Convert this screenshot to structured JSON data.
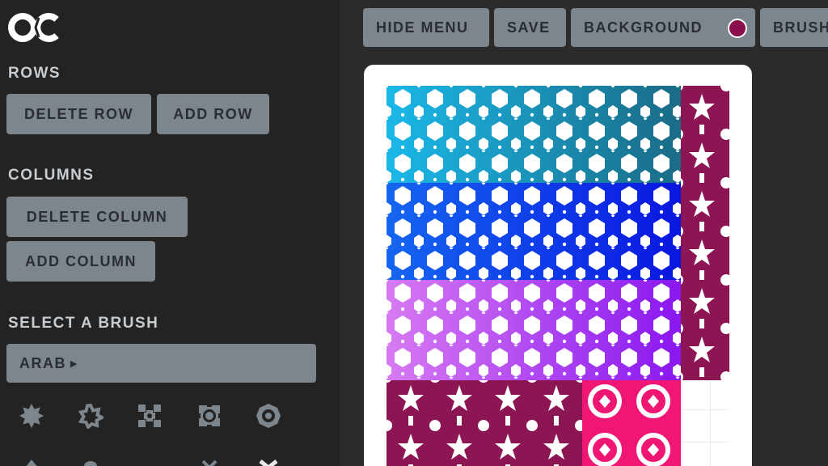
{
  "logo": {
    "icon": "oc-logo-icon"
  },
  "sidebar": {
    "rows": {
      "title": "ROWS",
      "delete_label": "DELETE ROW",
      "add_label": "ADD ROW"
    },
    "columns": {
      "title": "COLUMNS",
      "delete_label": "DELETE COLUMN",
      "add_label": "ADD COLUMN"
    },
    "brush": {
      "title": "SELECT A BRUSH",
      "selected": "ARAB",
      "icons": [
        "star-8-brush-icon",
        "star-outline-brush-icon",
        "cross-knot-brush-icon",
        "square-knot-brush-icon",
        "ring-knot-brush-icon",
        "arrow-brush-icon",
        "petal-brush-icon",
        "x-brush-icon",
        "x-bold-brush-icon"
      ]
    }
  },
  "toolbar": {
    "hide_menu_label": "HIDE MENU",
    "save_label": "SAVE",
    "background_label": "BACKGROUND",
    "brush_label": "BRUSH"
  },
  "colors": {
    "background_swatch": "#8a0f4e",
    "rows": [
      "#1ab8e8",
      "#1566f0",
      "#d77af2",
      "#8c1553"
    ],
    "row_end": [
      "#1a6b86",
      "#0a16e0",
      "#8a17f0",
      "#8c1553"
    ],
    "right_column": "#8c1553",
    "accent_tile": "#f01673"
  }
}
